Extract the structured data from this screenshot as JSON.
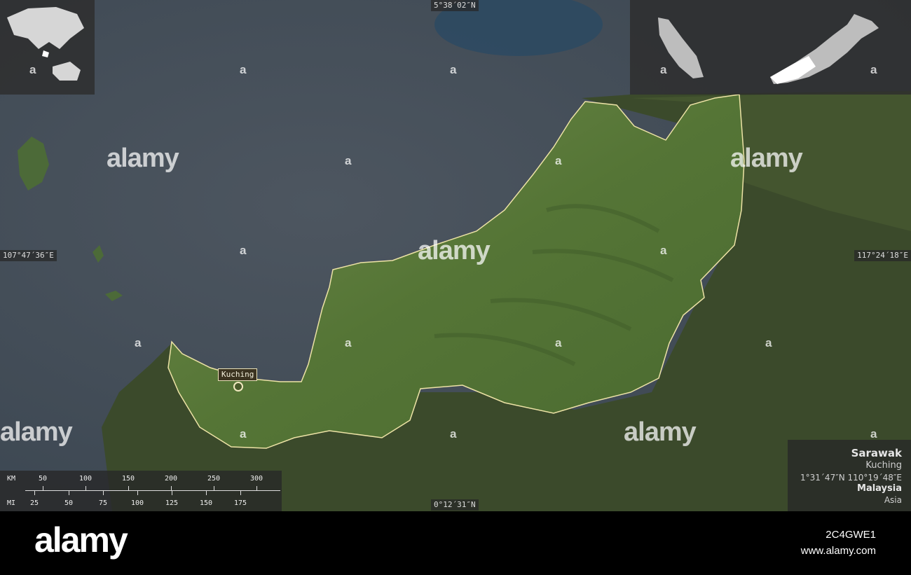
{
  "map": {
    "coords": {
      "top": "5°38´02″N",
      "bottom": "0°12´31″N",
      "left": "107°47´36″E",
      "right": "117°24´18″E"
    },
    "city_label": "Kuching",
    "colors": {
      "sea": "#3d4750",
      "land_region": "#5b7a3e",
      "land_other": "#3a4a2c",
      "border": "#ede3a6"
    }
  },
  "scale": {
    "km_label": "KM",
    "mi_label": "MI",
    "km_ticks": [
      "50",
      "100",
      "150",
      "200",
      "250",
      "300"
    ],
    "mi_ticks": [
      "25",
      "50",
      "75",
      "100",
      "125",
      "150",
      "175"
    ]
  },
  "legend": {
    "region": "Sarawak",
    "capital": "Kuching",
    "coordinates": "1°31´47″N 110°19´48″E",
    "country": "Malaysia",
    "continent": "Asia"
  },
  "watermark": {
    "text": "alamy",
    "image_id": "2C4GWE1",
    "url": "www.alamy.com"
  }
}
